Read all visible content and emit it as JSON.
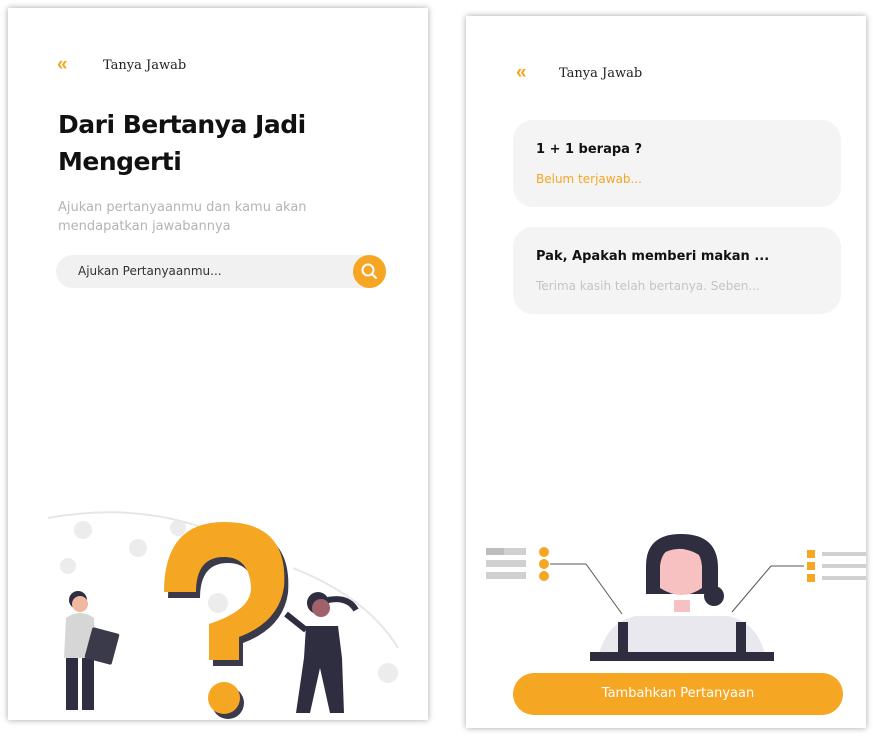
{
  "colors": {
    "accent": "#f5a623",
    "text_dark": "#111111",
    "text_muted": "#b4b4b4",
    "card_bg": "#f4f4f4"
  },
  "left_screen": {
    "topbar": {
      "back_icon": "double-chevron-left-icon",
      "title": "Tanya Jawab"
    },
    "headline": "Dari Bertanya Jadi Mengerti",
    "subtitle": "Ajukan pertanyaanmu dan kamu akan mendapatkan jawabannya",
    "search": {
      "placeholder": "Ajukan Pertanyaanmu...",
      "icon": "search-icon"
    }
  },
  "right_screen": {
    "topbar": {
      "back_icon": "double-chevron-left-icon",
      "title": "Tanya Jawab"
    },
    "questions": [
      {
        "question": "1 + 1 berapa ?",
        "answer": "Belum terjawab...",
        "answer_color": "#f5a623"
      },
      {
        "question": "Pak, Apakah memberi makan ...",
        "answer": "Terima kasih telah bertanya. Seben...",
        "answer_color": "#c4c4c4"
      }
    ],
    "add_button_label": "Tambahkan Pertanyaan"
  }
}
